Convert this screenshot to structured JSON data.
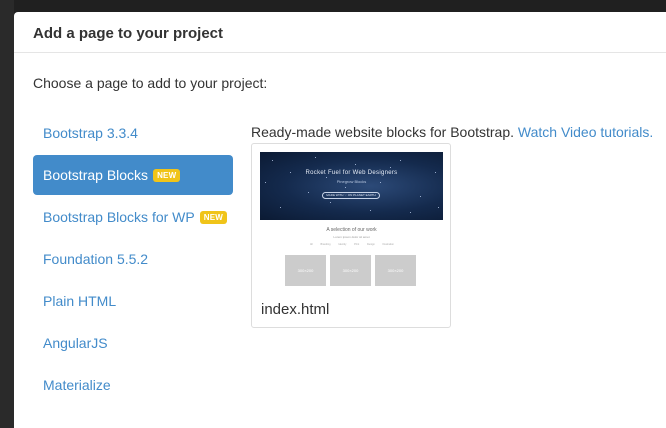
{
  "modal": {
    "title": "Add a page to your project",
    "prompt": "Choose a page to add to your project:"
  },
  "nav": {
    "items": [
      {
        "label": "Bootstrap 3.3.4",
        "badge": "",
        "active": false
      },
      {
        "label": "Bootstrap Blocks",
        "badge": "NEW",
        "active": true
      },
      {
        "label": "Bootstrap Blocks for WP",
        "badge": "NEW",
        "active": false
      },
      {
        "label": "Foundation 5.5.2",
        "badge": "",
        "active": false
      },
      {
        "label": "Plain HTML",
        "badge": "",
        "active": false
      },
      {
        "label": "AngularJS",
        "badge": "",
        "active": false
      },
      {
        "label": "Materialize",
        "badge": "",
        "active": false
      }
    ]
  },
  "content": {
    "lead_text": "Ready-made website blocks for Bootstrap.",
    "tutorials_link": "Watch Video tutorials.",
    "card": {
      "label": "index.html",
      "thumbnail": {
        "hero_title": "Rocket Fuel for Web Designers",
        "hero_subtitle": "Pinegrow Blocks",
        "hero_button": "MADE WITH ♡ ON PLANET EARTH",
        "section_title": "A selection of our work",
        "section_subtitle": "Lorem ipsum dolor sit amet",
        "filters": [
          "All",
          "Branding",
          "Identity",
          "Print",
          "Design",
          "Illustration"
        ],
        "tiles": [
          "300×200",
          "300×200",
          "300×200"
        ]
      }
    }
  },
  "colors": {
    "link": "#428bca",
    "active_bg": "#428bca",
    "badge": "#f0c419",
    "backdrop": "#202020"
  }
}
